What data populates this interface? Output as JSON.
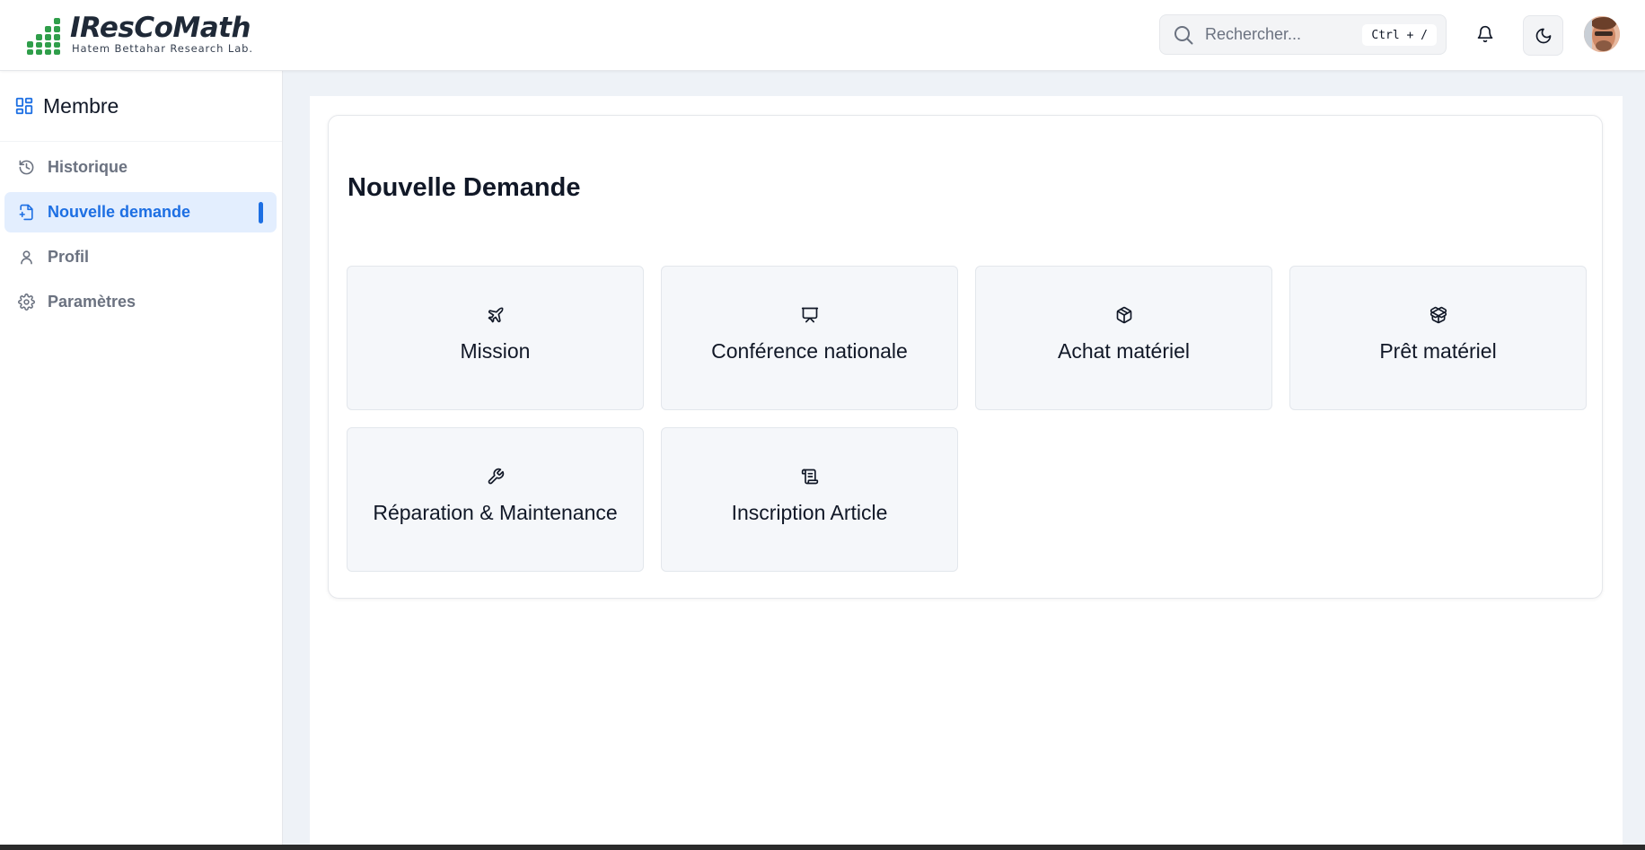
{
  "header": {
    "logo_title": "IResCoMath",
    "logo_subtitle": "Hatem Bettahar Research Lab.",
    "search_placeholder": "Rechercher...",
    "search_shortcut": "Ctrl + /",
    "icons": [
      "search-icon",
      "bell-icon",
      "moon-icon"
    ]
  },
  "sidebar": {
    "title": "Membre",
    "title_icon": "dashboard-grid-icon",
    "items": [
      {
        "label": "Historique",
        "icon": "history-icon",
        "active": false
      },
      {
        "label": "Nouvelle demande",
        "icon": "file-plus-icon",
        "active": true
      },
      {
        "label": "Profil",
        "icon": "user-icon",
        "active": false
      },
      {
        "label": "Paramètres",
        "icon": "gear-icon",
        "active": false
      }
    ]
  },
  "main": {
    "title": "Nouvelle Demande",
    "tiles": [
      {
        "label": "Mission",
        "icon": "plane-icon"
      },
      {
        "label": "Conférence nationale",
        "icon": "presentation-icon"
      },
      {
        "label": "Achat matériel",
        "icon": "package-icon"
      },
      {
        "label": "Prêt matériel",
        "icon": "package-open-icon"
      },
      {
        "label": "Réparation & Maintenance",
        "icon": "wrench-icon"
      },
      {
        "label": "Inscription Article",
        "icon": "scroll-icon"
      }
    ]
  },
  "colors": {
    "accent": "#1d6fe3",
    "active_bg": "#e3eefe",
    "logo_green": "#2f9e4a",
    "page_bg": "#eef2f7",
    "tile_bg": "#f5f7fa"
  }
}
